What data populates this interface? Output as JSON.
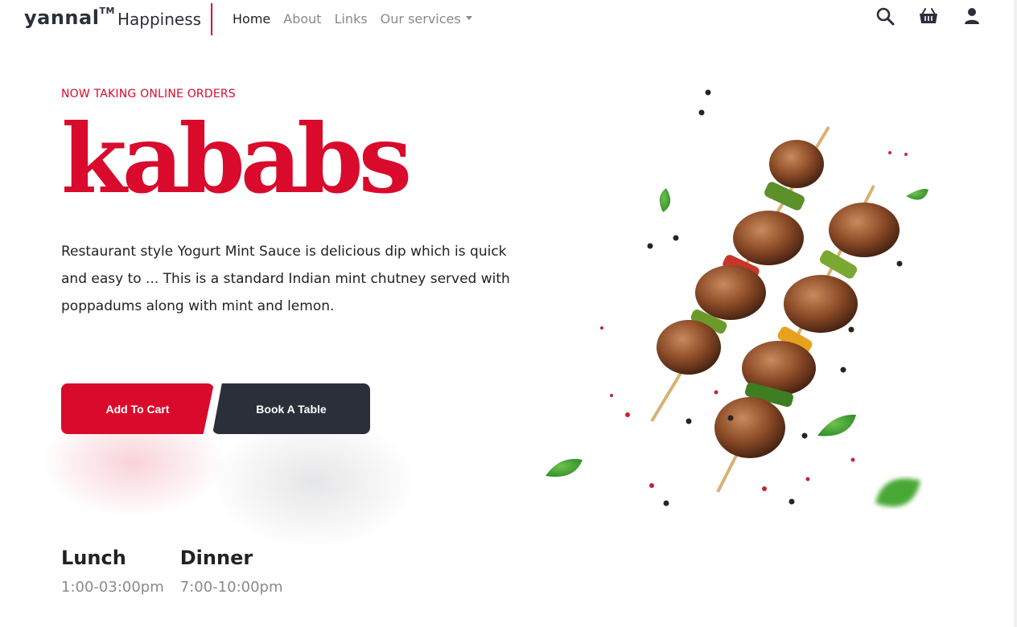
{
  "brand": {
    "logo": "yannal",
    "logo_mark": "TM",
    "tagline": "Happiness"
  },
  "nav": {
    "items": [
      {
        "label": "Home",
        "active": true
      },
      {
        "label": "About",
        "active": false
      },
      {
        "label": "Links",
        "active": false
      },
      {
        "label": "Our services",
        "active": false,
        "dropdown": true
      }
    ]
  },
  "header_icons": [
    "search-icon",
    "basket-icon",
    "user-icon"
  ],
  "hero": {
    "eyebrow": "NOW TAKING ONLINE ORDERS",
    "title": "kababs",
    "description": "Restaurant style Yogurt Mint Sauce is delicious dip which is quick and easy to ... This is a standard Indian mint chutney served with poppadums along with mint and lemon.",
    "primary_button": "Add To Cart",
    "secondary_button": "Book A Table"
  },
  "hours": [
    {
      "meal": "Lunch",
      "time": "1:00-03:00pm"
    },
    {
      "meal": "Dinner",
      "time": "7:00-10:00pm"
    }
  ],
  "colors": {
    "accent": "#d90a2c",
    "dark": "#2b2f3a",
    "muted": "#8a8a8a"
  }
}
